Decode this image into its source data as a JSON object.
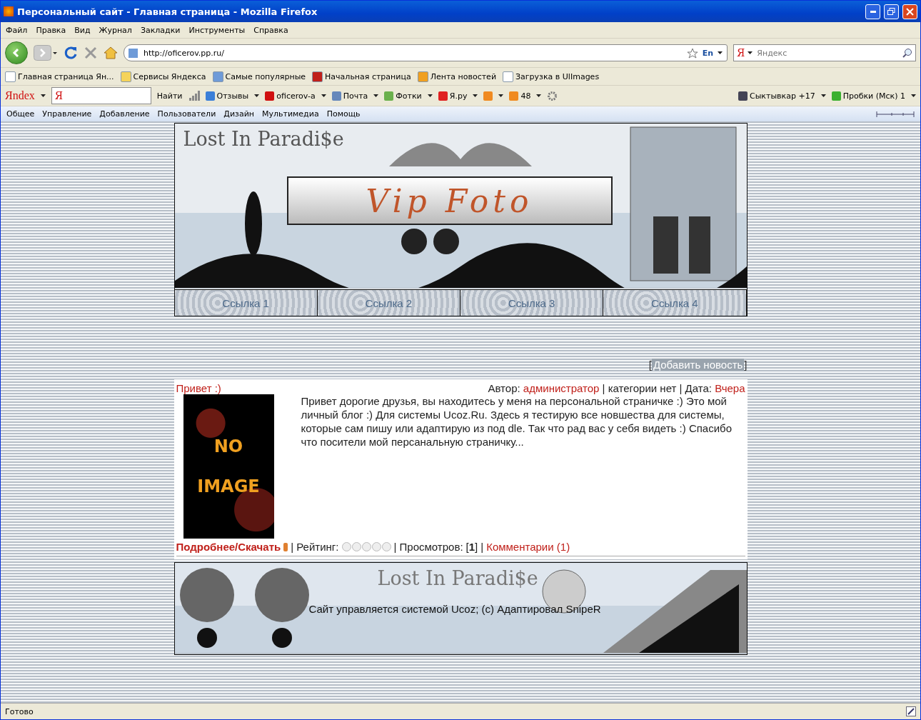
{
  "window": {
    "title": "Персональный сайт - Главная страница - Mozilla Firefox"
  },
  "menu": [
    "Файл",
    "Правка",
    "Вид",
    "Журнал",
    "Закладки",
    "Инструменты",
    "Справка"
  ],
  "address": {
    "value": "http://oficerov.pp.ru/",
    "lang": "En"
  },
  "search": {
    "placeholder": "Яндекс",
    "engine": "Я"
  },
  "bookmarks": [
    "Главная страница Ян...",
    "Сервисы Яндекса",
    "Самые популярные",
    "Начальная страница",
    "Лента новостей",
    "Загрузка в UlImages"
  ],
  "yandex_bar": {
    "logo": "Яndex",
    "field_logo": "Я",
    "find": "Найти",
    "items": [
      "Отзывы",
      "oficerov-a",
      "Почта",
      "Фотки",
      "Я.ру",
      "48"
    ],
    "weather": "Сыктывкар +17",
    "traffic": "Пробки (Мск) 1"
  },
  "ucoz_panel": [
    "Общее",
    "Управление",
    "Добавление",
    "Пользователи",
    "Дизайн",
    "Мультимедиа",
    "Помощь"
  ],
  "site": {
    "logo": "Lost In Paradi$e",
    "banner_title": "Vip Foto",
    "nav": [
      "Ссылка 1",
      "Ссылка 2",
      "Ссылка 3",
      "Ссылка 4"
    ],
    "add_news": "Добавить новость",
    "add_news_brackets": [
      "[",
      "]"
    ],
    "post": {
      "title": "Привет :)",
      "author_label": "Автор:",
      "author": "администратор",
      "category": "| категории нет | Дата:",
      "date": "Вчера",
      "image_text": "NO IMAGE",
      "body": "Привет дорогие друзья, вы находитесь у меня на персональной страничке :) Это мой личный блог :) Для системы Ucoz.Ru. Здесь я тестирую все новшества для системы, которые сам пишу или адаптирую из под dle. Так что рад вас у себя видеть :) Спасибо что посители мой персанальную страничку...",
      "more": "Подробнее/Скачать",
      "rating_label": "| Рейтинг:",
      "stars": 0,
      "views_label": "| Просмотров:",
      "views": "[**1**]",
      "separator": "|",
      "comments": "Комментарии (1)"
    },
    "footer": {
      "logo": "Lost In Paradi$e",
      "text": "Сайт управляется системой Ucoz; (c) Адаптировал SnipeR"
    }
  },
  "status": "Готово"
}
